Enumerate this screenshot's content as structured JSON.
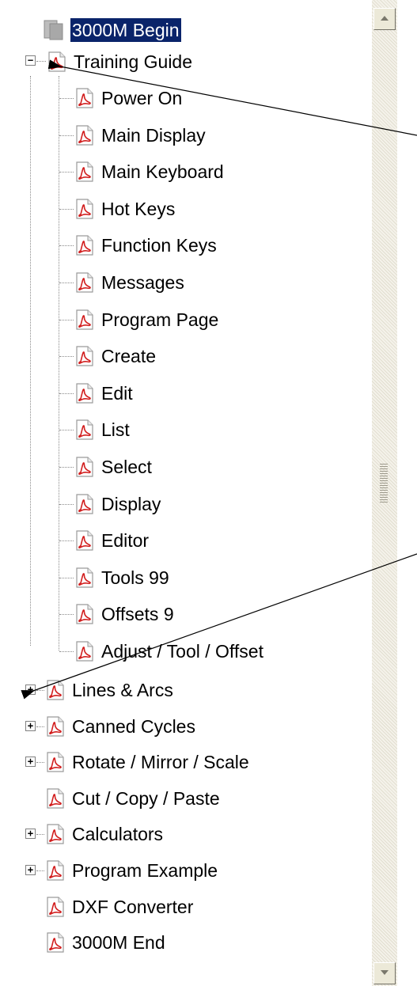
{
  "tree": {
    "items": [
      {
        "label": "3000M Begin",
        "icon": "generic-document-icon",
        "selected": true
      },
      {
        "label": "Training Guide",
        "icon": "pdf-icon",
        "expander": "minus"
      },
      {
        "label": "Power On",
        "icon": "pdf-icon"
      },
      {
        "label": "Main Display",
        "icon": "pdf-icon"
      },
      {
        "label": "Main Keyboard",
        "icon": "pdf-icon"
      },
      {
        "label": "Hot Keys",
        "icon": "pdf-icon"
      },
      {
        "label": "Function Keys",
        "icon": "pdf-icon"
      },
      {
        "label": "Messages",
        "icon": "pdf-icon"
      },
      {
        "label": "Program Page",
        "icon": "pdf-icon"
      },
      {
        "label": "Create",
        "icon": "pdf-icon"
      },
      {
        "label": "Edit",
        "icon": "pdf-icon"
      },
      {
        "label": "List",
        "icon": "pdf-icon"
      },
      {
        "label": "Select",
        "icon": "pdf-icon"
      },
      {
        "label": "Display",
        "icon": "pdf-icon"
      },
      {
        "label": "Editor",
        "icon": "pdf-icon"
      },
      {
        "label": "Tools 99",
        "icon": "pdf-icon"
      },
      {
        "label": "Offsets 9",
        "icon": "pdf-icon"
      },
      {
        "label": "Adjust / Tool / Offset",
        "icon": "pdf-icon"
      },
      {
        "label": "Lines & Arcs",
        "icon": "pdf-icon",
        "expander": "plus"
      },
      {
        "label": "Canned Cycles",
        "icon": "pdf-icon",
        "expander": "plus"
      },
      {
        "label": "Rotate / Mirror / Scale",
        "icon": "pdf-icon",
        "expander": "plus"
      },
      {
        "label": "Cut / Copy / Paste",
        "icon": "pdf-icon"
      },
      {
        "label": "Calculators",
        "icon": "pdf-icon",
        "expander": "plus"
      },
      {
        "label": "Program Example",
        "icon": "pdf-icon",
        "expander": "plus"
      },
      {
        "label": "DXF Converter",
        "icon": "pdf-icon"
      },
      {
        "label": "3000M End",
        "icon": "pdf-icon"
      }
    ]
  },
  "symbols": {
    "minus": "−",
    "plus": "+"
  },
  "colors": {
    "pdf_red": "#d21f1f",
    "selection": "#0a246a",
    "scrollbar": "#ece9d8"
  },
  "scrollbar": {
    "up_icon": "arrow-up-icon",
    "down_icon": "arrow-down-icon"
  }
}
